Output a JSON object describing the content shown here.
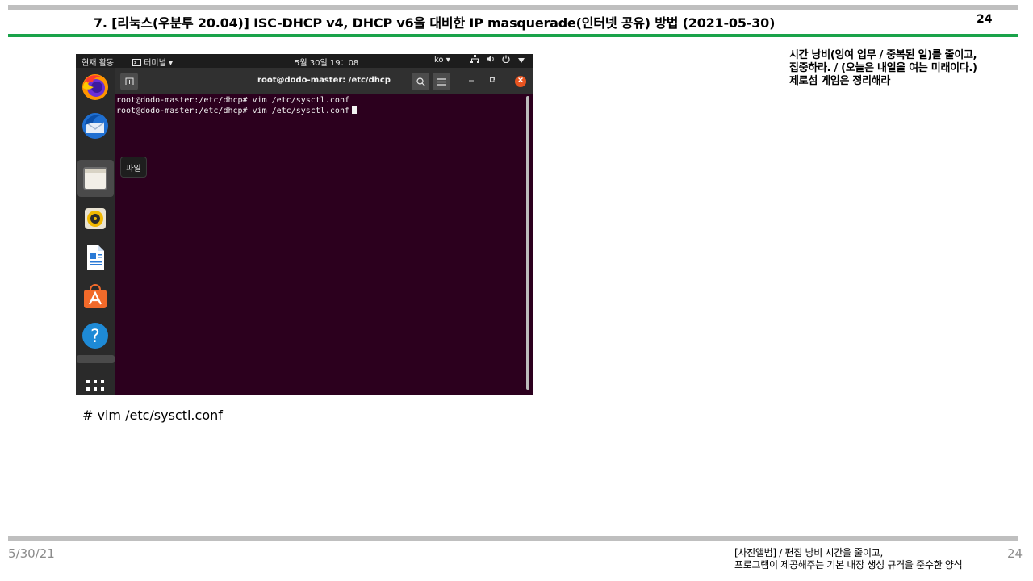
{
  "slide": {
    "title": "7. [리눅스(우분투 20.04)] ISC-DHCP v4, DHCP v6을 대비한 IP masquerade(인터넷 공유) 방법 (2021-05-30)",
    "page_number": "24",
    "note_lines": [
      "시간 낭비(잉여 업무 / 중복된 일)를 줄이고,",
      "집중하라. / (오늘은 내일을 여는 미래이다.)",
      "제로섬 게임은 정리해라"
    ],
    "caption": "# vim /etc/sysctl.conf"
  },
  "topbar": {
    "activities": "현재 활동",
    "app_menu": "터미널 ▾",
    "clock": "5월 30일  19：08",
    "input_method": "ko ▾"
  },
  "dock": {
    "tooltip": "파일",
    "items": [
      "firefox",
      "thunderbird",
      "files",
      "rhythmbox",
      "libreoffice-writer",
      "ubuntu-software",
      "help",
      "show-applications"
    ]
  },
  "terminal": {
    "title": "root@dodo-master: /etc/dhcp",
    "lines": [
      "root@dodo-master:/etc/dhcp# vim /etc/sysctl.conf",
      "root@dodo-master:/etc/dhcp# vim /etc/sysctl.conf"
    ]
  },
  "footer": {
    "date": "5/30/21",
    "line1": "[사진앨범] / 편집 낭비 시간을 줄이고,",
    "line2": "프로그램이 제공해주는 기본 내장 생성 규격을 준수한 양식",
    "page_number": "24"
  },
  "colors": {
    "accent_green": "#1aa34a",
    "terminal_bg": "#2c001e",
    "ubuntu_orange": "#e95420"
  }
}
